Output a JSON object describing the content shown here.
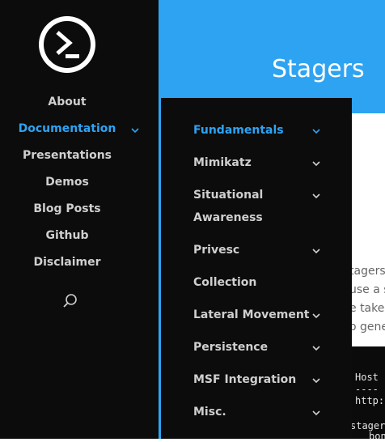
{
  "sidebar": {
    "items": [
      {
        "label": "About"
      },
      {
        "label": "Documentation"
      },
      {
        "label": "Presentations"
      },
      {
        "label": "Demos"
      },
      {
        "label": "Blog Posts"
      },
      {
        "label": "Github"
      },
      {
        "label": "Disclaimer"
      }
    ],
    "active_color": "#2ea3f2",
    "search_icon": "search-icon",
    "logo_icon": "sigma-shield-logo"
  },
  "header": {
    "title": "Stagers",
    "bg_color": "#2ea3f2"
  },
  "dropdown": {
    "items": [
      {
        "label": "Fundamentals"
      },
      {
        "label": "Mimikatz"
      },
      {
        "label": "Situational"
      },
      {
        "label": "Awareness"
      },
      {
        "label": "Privesc"
      },
      {
        "label": "Collection"
      },
      {
        "label": "Lateral Movement"
      },
      {
        "label": "Persistence"
      },
      {
        "label": "MSF Integration"
      },
      {
        "label": "Misc."
      }
    ]
  },
  "content": {
    "para": [
      "tagers",
      "use a s",
      "e taken",
      "o gene"
    ],
    "code": [
      "Host",
      "----",
      "http:",
      "stager",
      "bon"
    ]
  }
}
